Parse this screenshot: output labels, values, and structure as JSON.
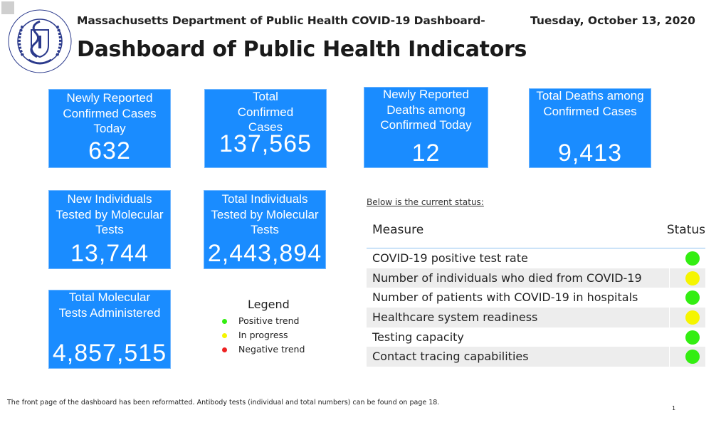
{
  "header": {
    "subtitle": "Massachusetts Department of Public Health COVID-19 Dashboard-",
    "date": "Tuesday, October 13, 2020",
    "title": "Dashboard of Public Health Indicators",
    "seal_icon": "dph-seal-icon"
  },
  "colors": {
    "card_blue": "#1a8cff",
    "positive": "#33ee11",
    "in_progress": "#f5f500",
    "negative": "#ee2222",
    "table_rule": "#8cc1f0"
  },
  "cards": [
    {
      "label": "Newly Reported Confirmed Cases Today",
      "value": "632"
    },
    {
      "label": "Total Confirmed Cases",
      "value": "137,565"
    },
    {
      "label": "Newly Reported Deaths among Confirmed Today",
      "value": "12"
    },
    {
      "label": "Total Deaths among Confirmed Cases",
      "value": "9,413"
    },
    {
      "label": "New Individuals Tested by Molecular Tests",
      "value": "13,744"
    },
    {
      "label": "Total Individuals Tested by Molecular Tests",
      "value": "2,443,894"
    },
    {
      "label": "Total Molecular Tests Administered",
      "value": "4,857,515"
    }
  ],
  "legend": {
    "title": "Legend",
    "items": [
      {
        "label": "Positive trend",
        "status": "positive"
      },
      {
        "label": "In progress",
        "status": "in_progress"
      },
      {
        "label": "Negative trend",
        "status": "negative"
      }
    ]
  },
  "status_table": {
    "intro": "Below is the current status:",
    "columns": [
      "Measure",
      "Status"
    ],
    "rows": [
      {
        "measure": "COVID-19 positive test rate",
        "status": "positive"
      },
      {
        "measure": "Number of individuals who died from COVID-19",
        "status": "in_progress"
      },
      {
        "measure": "Number of patients with COVID-19 in hospitals",
        "status": "positive"
      },
      {
        "measure": "Healthcare system readiness",
        "status": "in_progress"
      },
      {
        "measure": "Testing capacity",
        "status": "positive"
      },
      {
        "measure": "Contact tracing capabilities",
        "status": "positive"
      }
    ]
  },
  "footer": {
    "note": "The front page of the dashboard has been reformatted. Antibody tests (individual and total numbers) can be found on page 18.",
    "page_number": "1"
  }
}
